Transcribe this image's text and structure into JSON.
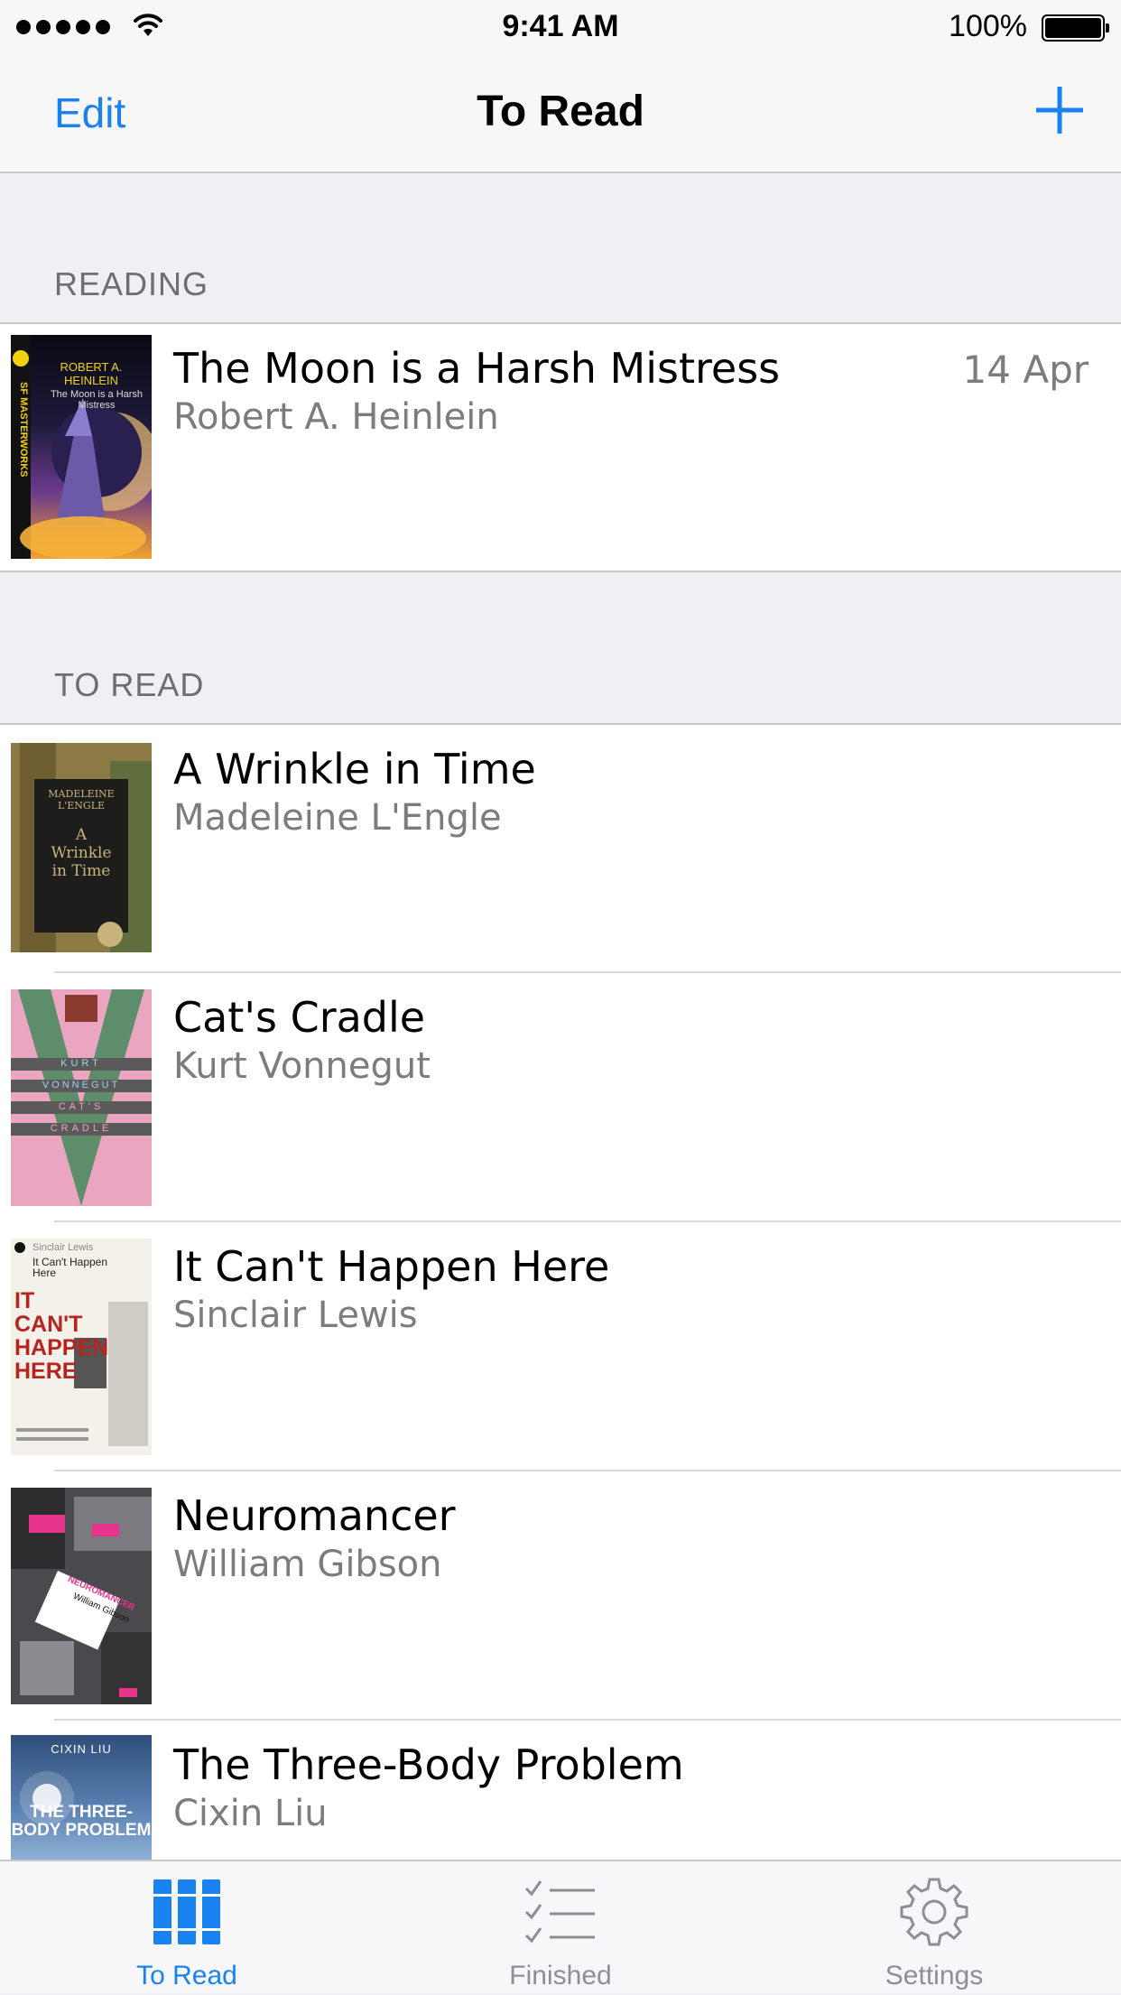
{
  "status_bar": {
    "time": "9:41 AM",
    "battery": "100%"
  },
  "nav": {
    "left": "Edit",
    "title": "To Read"
  },
  "sections": [
    {
      "header": "READING",
      "books": [
        {
          "title": "The Moon is a Harsh Mistress",
          "author": "Robert A. Heinlein",
          "date": "14 Apr",
          "cover": {
            "series": "SF MASTERWORKS",
            "author": "ROBERT A. HEINLEIN",
            "title": "The Moon is a Harsh Mistress"
          }
        }
      ]
    },
    {
      "header": "TO READ",
      "books": [
        {
          "title": "A Wrinkle in Time",
          "author": "Madeleine L'Engle",
          "cover": {
            "author": "MADELEINE L'ENGLE",
            "title": "A Wrinkle in Time"
          }
        },
        {
          "title": "Cat's Cradle",
          "author": "Kurt Vonnegut",
          "cover": {
            "line1": "KURT",
            "line2": "VONNEGUT",
            "line3": "CAT'S",
            "line4": "CRADLE"
          }
        },
        {
          "title": "It Can't Happen Here",
          "author": "Sinclair Lewis",
          "cover": {
            "author": "Sinclair Lewis",
            "title": "It Can't Happen Here",
            "big": "IT CAN'T HAPPEN HERE"
          }
        },
        {
          "title": "Neuromancer",
          "author": "William Gibson",
          "cover": {
            "title": "NEUROMANCER",
            "author": "William Gibson"
          }
        },
        {
          "title": "The Three-Body Problem",
          "author": "Cixin Liu",
          "cover": {
            "author": "CIXIN LIU",
            "title": "THE THREE-BODY PROBLEM"
          }
        }
      ]
    }
  ],
  "tabs": [
    {
      "label": "To Read",
      "icon": "books-icon",
      "active": true
    },
    {
      "label": "Finished",
      "icon": "checklist-icon",
      "active": false
    },
    {
      "label": "Settings",
      "icon": "gear-icon",
      "active": false
    }
  ],
  "colors": {
    "accent": "#1a82f0",
    "inactive": "#8e8e93",
    "background": "#efeff4",
    "secondary_text": "#7c7c7c"
  }
}
